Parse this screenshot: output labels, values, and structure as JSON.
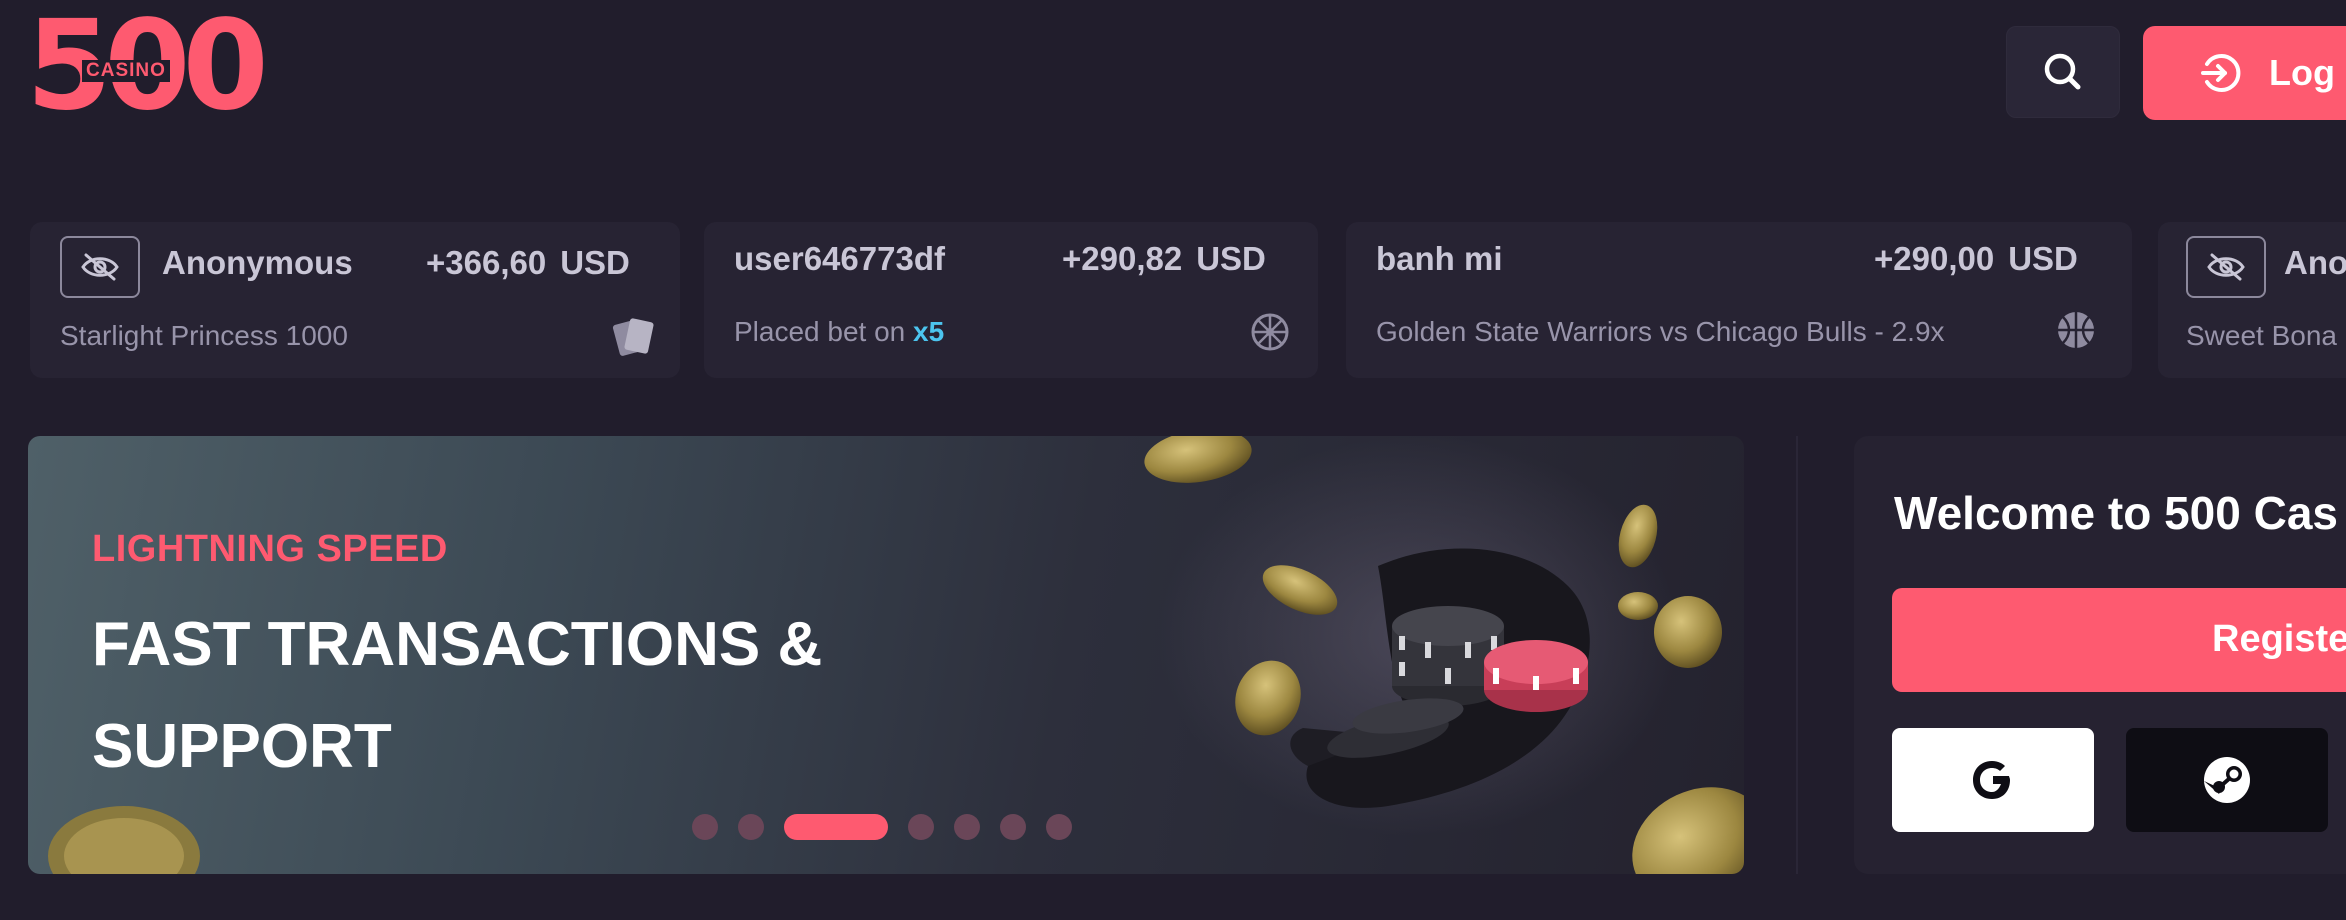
{
  "header": {
    "logo": {
      "digits": "500",
      "word": "CASINO"
    },
    "login_label": "Log",
    "icons": {
      "search": "search-icon",
      "login": "login-icon"
    }
  },
  "bets": [
    {
      "user": "Anonymous",
      "anonymous": true,
      "amount": "+366,60",
      "currency": "USD",
      "game": "Starlight Princess 1000",
      "icon": "slots-cards-icon"
    },
    {
      "user": "user646773df",
      "anonymous": false,
      "amount": "+290,82",
      "currency": "USD",
      "game_prefix": "Placed bet on",
      "multiplier": "x5",
      "icon": "wheel-icon"
    },
    {
      "user": "banh mi",
      "anonymous": false,
      "amount": "+290,00",
      "currency": "USD",
      "game": "Golden State Warriors vs Chicago Bulls - 2.9x",
      "icon": "basketball-icon"
    },
    {
      "user": "Ano",
      "anonymous": true,
      "game": "Sweet Bona"
    }
  ],
  "banner": {
    "subtitle": "LIGHTNING SPEED",
    "title_line1": "FAST TRANSACTIONS &",
    "title_line2": "SUPPORT",
    "slide_count": 7,
    "active_slide": 3
  },
  "welcome": {
    "title": "Welcome to 500 Cas",
    "register_label": "Registe",
    "social": [
      "google-icon",
      "steam-icon"
    ]
  },
  "colors": {
    "background": "#211d2c",
    "accent": "#fe5a70",
    "card": "#272333",
    "multiplier": "#4cc4ee"
  }
}
